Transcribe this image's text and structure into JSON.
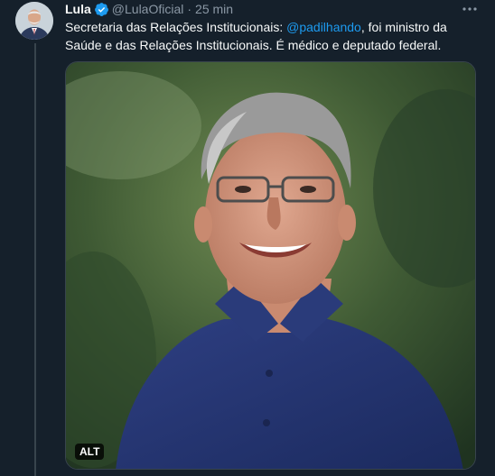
{
  "tweet": {
    "author_name": "Lula",
    "handle": "@LulaOficial",
    "separator": "·",
    "time": "25 min",
    "text_prefix": "Secretaria das Relações Institucionais: ",
    "mention": "@padilhando",
    "text_suffix": ", foi ministro da Saúde e das Relações Institucionais. É médico e deputado federal.",
    "alt_badge": "ALT"
  },
  "icons": {
    "verified": "verified-badge-icon",
    "more": "more-options-icon"
  },
  "colors": {
    "background": "#15202b",
    "text": "#f7f9f9",
    "secondary": "#8b98a5",
    "accent": "#1d9bf0",
    "border": "#38444d"
  }
}
